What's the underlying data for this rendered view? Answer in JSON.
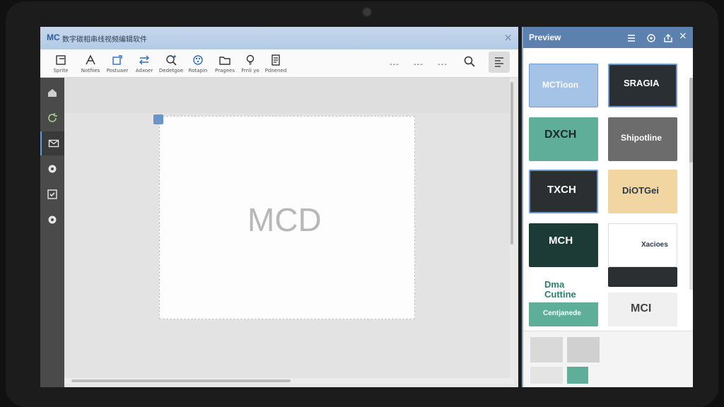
{
  "app": {
    "logo_text": "MC",
    "title": "数字碳相串线视频编辑软件",
    "close_symbol": "×"
  },
  "toolbar": {
    "tools": [
      {
        "label": "Sprite",
        "icon": "crop-icon"
      },
      {
        "label": "Notfiies",
        "icon": "text-tool-icon"
      },
      {
        "label": "Postuaer",
        "icon": "resize-icon"
      },
      {
        "label": "Adxoer",
        "icon": "swap-icon"
      },
      {
        "label": "Dedetgoe",
        "icon": "magic-search-icon"
      },
      {
        "label": "Rotapin",
        "icon": "palette-icon"
      },
      {
        "label": "Pragees",
        "icon": "folder-icon"
      },
      {
        "label": "Frnli yo",
        "icon": "lightbulb-icon"
      },
      {
        "label": "Pdnened",
        "icon": "document-icon"
      }
    ],
    "more": [
      "---",
      "---",
      "---"
    ]
  },
  "sidenav": {
    "items": [
      "home-icon",
      "refresh-icon",
      "mail-icon",
      "settings-icon",
      "checkbox-icon",
      "gear-icon"
    ]
  },
  "canvas": {
    "logo_text": "MCD"
  },
  "preview": {
    "title": "Preview",
    "close_symbol": "×",
    "thumbnails": [
      {
        "text": "MCTioon",
        "bg": "#a5c3e6",
        "fg": "#ffffff"
      },
      {
        "text": "SRAGIA",
        "bg": "#2a2f33",
        "fg": "#ffffff"
      },
      {
        "text": "DXCH",
        "bg": "#5fae9a",
        "fg": "#1d2a2a"
      },
      {
        "text": "Shipotline",
        "bg": "#6c6c6c",
        "fg": "#ffffff"
      },
      {
        "text": "TXCH",
        "bg": "#2b2f32",
        "fg": "#ffffff"
      },
      {
        "text": "DiOTGei",
        "bg": "#f2d6a2",
        "fg": "#2b3a4a"
      },
      {
        "text": "MCH",
        "bg": "#1d3b36",
        "fg": "#ffffff"
      },
      {
        "text": "Xacioes",
        "bg": "#ffffff",
        "fg": "#2b3a4a"
      },
      {
        "text": "Dma Cuttine",
        "bg": "#ffffff",
        "fg": "#2a8070"
      },
      {
        "text": "MCI",
        "bg": "#f0f0f0",
        "fg": "#444444"
      }
    ],
    "strip_text": "Centjanede"
  },
  "colors": {
    "titlebar": "#bcd0e8",
    "preview_header": "#5c81ae",
    "sidenav": "#4a4a4a"
  }
}
